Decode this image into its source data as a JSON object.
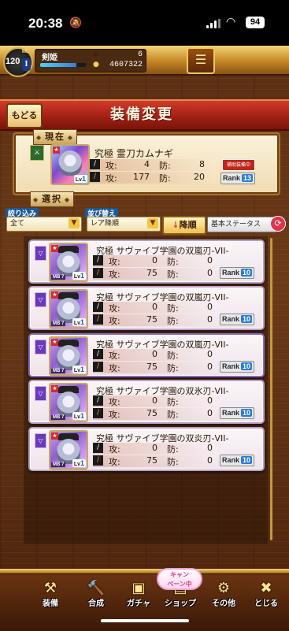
{
  "status": {
    "time": "20:38",
    "battery": "94"
  },
  "player": {
    "rank": "120",
    "rank_prefix": "ML",
    "rank_roman": "I",
    "name": "剣姫",
    "coins": "6",
    "money": "4607322",
    "exp_fraction": 0.8
  },
  "title": {
    "back_label": "もどる",
    "page_title": "装備変更"
  },
  "current": {
    "tag": "現在",
    "name": "究極 霊刀カムナギ",
    "attack_label": "攻:",
    "defense_label": "防:",
    "atk": "4",
    "def": "8",
    "weapon_atk": "177",
    "weapon_def": "20",
    "equipped_badge": "補助装備中",
    "rank_label": "Rank",
    "rank_value": "13",
    "card_lv": "1"
  },
  "selection_tag": "選択",
  "filter": {
    "filter_label": "絞り込み",
    "filter_value": "全て",
    "sort_label": "並び替え",
    "sort_value": "レア降順",
    "order_button": "降順",
    "order_arrow": "↓",
    "base_status_button": "基本ステータス"
  },
  "items": [
    {
      "name": "究極 サヴァイブ学園の双嵐刃-VII-",
      "atk": "0",
      "def": "0",
      "weapon_atk": "75",
      "weapon_def": "0",
      "rank": "10",
      "mb": "MB 7",
      "lv": "1"
    },
    {
      "name": "究極 サヴァイブ学園の双嵐刃-VII-",
      "atk": "0",
      "def": "0",
      "weapon_atk": "75",
      "weapon_def": "0",
      "rank": "10",
      "mb": "MB 7",
      "lv": "1"
    },
    {
      "name": "究極 サヴァイブ学園の双嵐刃-VII-",
      "atk": "0",
      "def": "0",
      "weapon_atk": "75",
      "weapon_def": "0",
      "rank": "10",
      "mb": "MB 7",
      "lv": "1"
    },
    {
      "name": "究極 サヴァイブ学園の双氷刃-VII-",
      "atk": "0",
      "def": "0",
      "weapon_atk": "75",
      "weapon_def": "0",
      "rank": "10",
      "mb": "MB 7",
      "lv": "1"
    },
    {
      "name": "究極 サヴァイブ学園の双炎刃-VII-",
      "atk": "0",
      "def": "0",
      "weapon_atk": "75",
      "weapon_def": "0",
      "rank": "10",
      "mb": "MB 7",
      "lv": "1"
    }
  ],
  "nav": {
    "equip": "装備",
    "synth": "合成",
    "gacha": "ガチャ",
    "shop": "ショップ",
    "other": "その他",
    "close": "とじる",
    "campaign_line1": "キャン",
    "campaign_line2": "ペーン中"
  },
  "icons": [
    "bell-slash-icon",
    "signal-icon",
    "wifi-icon",
    "battery-icon",
    "menu-icon",
    "sword-icon",
    "shield-icon",
    "sort-arrow-icon",
    "cycle-icon",
    "scrollbar"
  ]
}
